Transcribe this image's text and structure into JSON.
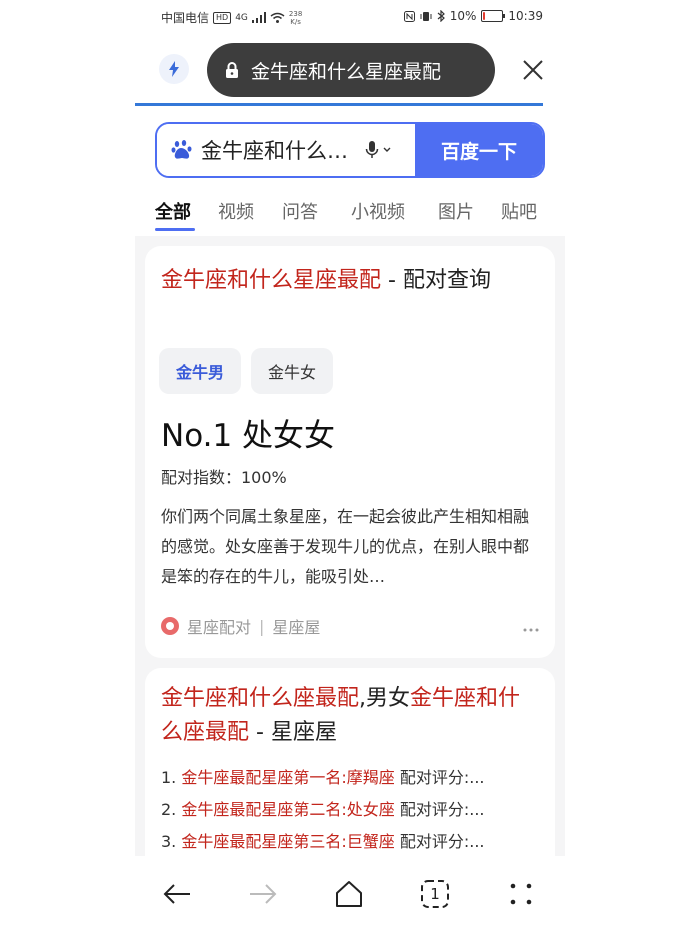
{
  "status_bar": {
    "carrier": "中国电信",
    "network": "HD",
    "signal": "4G",
    "speed_value": "238",
    "speed_unit": "K/s",
    "battery_percent": "10%",
    "battery_level": 0.1,
    "time": "10:39"
  },
  "url_bar": {
    "title": "金牛座和什么星座最配"
  },
  "search": {
    "query": "金牛座和什么星座最配",
    "button_label": "百度一下"
  },
  "tabs": [
    {
      "label": "全部",
      "active": true
    },
    {
      "label": "视频",
      "active": false
    },
    {
      "label": "问答",
      "active": false
    },
    {
      "label": "小视频",
      "active": false
    },
    {
      "label": "图片",
      "active": false
    },
    {
      "label": "贴吧",
      "active": false
    }
  ],
  "result1": {
    "title_highlight": "金牛座和什么星座最配",
    "title_rest": " - 配对查询",
    "chips": [
      "金牛男",
      "金牛女"
    ],
    "rank": "No.1 处女女",
    "score": "配对指数：100%",
    "description": "你们两个同属土象星座，在一起会彼此产生相知相融的感觉。处女座善于发现牛儿的优点，在别人眼中都是笨的存在的牛儿，能吸引处…",
    "source_a": "星座配对",
    "source_sep": "|",
    "source_b": "星座屋"
  },
  "result2": {
    "title_part1": "金牛座和什么座最配",
    "title_part2": ",男女",
    "title_part3": "金牛座",
    "title_part4": "和什么座最配",
    "title_part5": " - 星座屋",
    "items": [
      {
        "num": "1. ",
        "highlight": "金牛座最配星座第一名:摩羯座",
        "rest": " 配对评分:..."
      },
      {
        "num": "2. ",
        "highlight": "金牛座最配星座第二名:处女座",
        "rest": " 配对评分:..."
      },
      {
        "num": "3. ",
        "highlight": "金牛座最配星座第三名:巨蟹座",
        "rest": " 配对评分:..."
      }
    ]
  },
  "bottom_nav": {
    "tab_count": "1"
  },
  "colors": {
    "accent": "#4e6ef2",
    "highlight_red": "#c2251c",
    "pill": "#3d3d3d"
  }
}
